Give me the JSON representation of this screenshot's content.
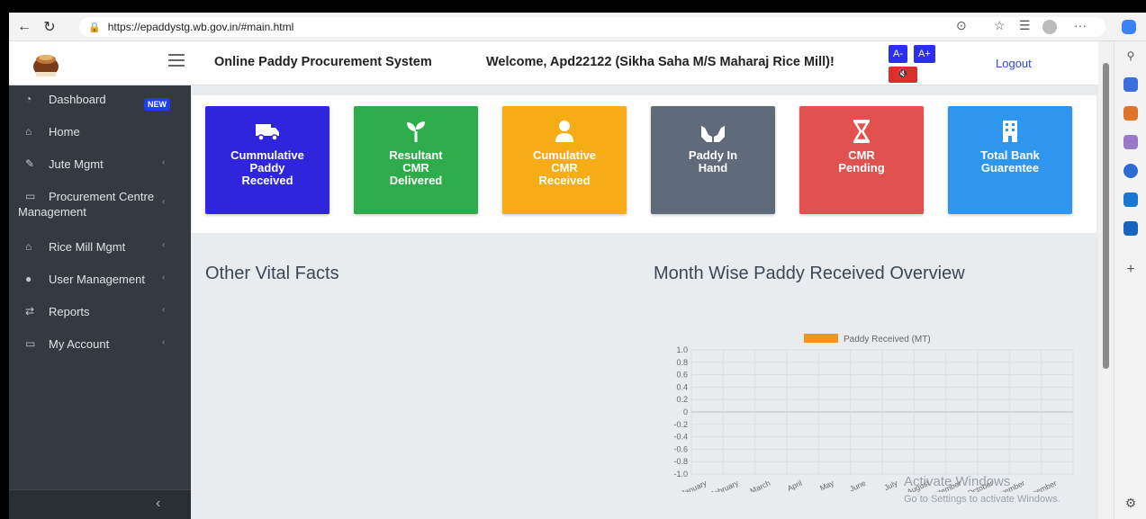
{
  "browser": {
    "url": "https://epaddystg.wb.gov.in/#main.html"
  },
  "header": {
    "system_title": "Online Paddy Procurement System",
    "welcome": "Welcome, Apd22122 (Sikha Saha M/S Maharaj Rice Mill)!",
    "font_decrease": "A-",
    "font_increase": "A+",
    "logout": "Logout"
  },
  "sidebar": {
    "items": [
      {
        "label": "Dashboard",
        "icon": "dashboard-icon",
        "badge": "NEW"
      },
      {
        "label": "Home",
        "icon": "home-icon"
      },
      {
        "label": "Jute Mgmt",
        "icon": "wrench-icon"
      },
      {
        "label": "Procurement Centre",
        "label2": "Management",
        "icon": "card-icon"
      },
      {
        "label": "Rice Mill Mgmt",
        "icon": "mill-icon"
      },
      {
        "label": "User Management",
        "icon": "user-icon"
      },
      {
        "label": "Reports",
        "icon": "exchange-icon"
      },
      {
        "label": "My Account",
        "icon": "card-icon"
      }
    ]
  },
  "cards": [
    {
      "line1": "Cummulative",
      "line2": "Paddy",
      "line3": "Received",
      "color": "#2e25dc",
      "icon": "truck-icon"
    },
    {
      "line1": "Resultant",
      "line2": "CMR",
      "line3": "Delivered",
      "color": "#2eab4a",
      "icon": "seedling-icon"
    },
    {
      "line1": "Cumulative",
      "line2": "CMR",
      "line3": "Received",
      "color": "#f5ac16",
      "icon": "user-icon"
    },
    {
      "line1": "Paddy In",
      "line2": "Hand",
      "line3": "",
      "color": "#5f6b7b",
      "icon": "hands-icon"
    },
    {
      "line1": "CMR",
      "line2": "Pending",
      "line3": "",
      "color": "#e0514f",
      "icon": "hourglass-icon"
    },
    {
      "line1": "Total Bank",
      "line2": "Guarentee",
      "line3": "",
      "color": "#2f96f0",
      "icon": "building-icon"
    }
  ],
  "sections": {
    "vital_facts": "Other Vital Facts",
    "month_wise": "Month Wise Paddy Received Overview"
  },
  "chart_data": {
    "type": "bar",
    "categories": [
      "January",
      "February",
      "March",
      "April",
      "May",
      "June",
      "July",
      "August",
      "September",
      "October",
      "November",
      "December"
    ],
    "series": [
      {
        "name": "Paddy Received (MT)",
        "values": [
          0,
          0,
          0,
          0,
          0,
          0,
          0,
          0,
          0,
          0,
          0,
          0
        ],
        "color": "#f0941e"
      }
    ],
    "ylim": [
      -1.0,
      1.0
    ],
    "yticks": [
      "1.0",
      "0.8",
      "0.6",
      "0.4",
      "0.2",
      "0",
      "-0.2",
      "-0.4",
      "-0.6",
      "-0.8",
      "-1.0"
    ],
    "grid": true,
    "legend": "top"
  },
  "watermark": {
    "line1": "Activate Windows",
    "line2": "Go to Settings to activate Windows."
  }
}
